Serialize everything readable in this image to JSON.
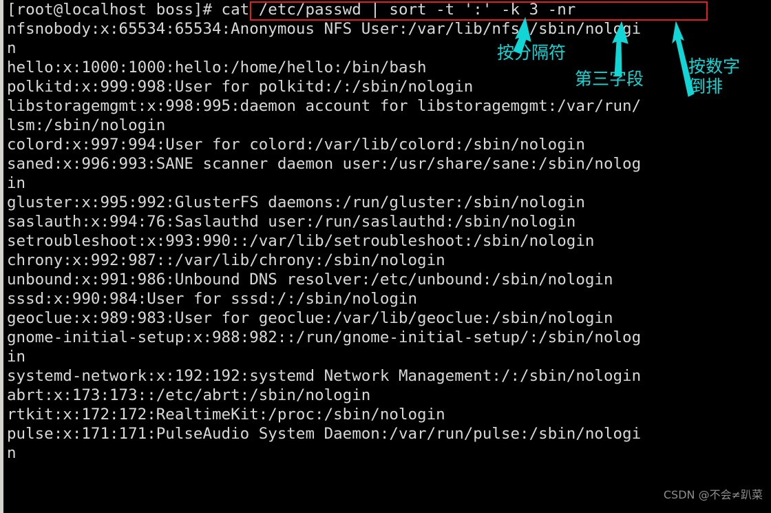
{
  "terminal": {
    "prompt": "[root@localhost boss]#",
    "command": " cat /etc/passwd | sort -t ':' -k 3 -nr",
    "prompt_line": "[root@localhost boss]# cat /etc/passwd | sort -t ':' -k 3 -nr",
    "output_lines": [
      "nfsnobody:x:65534:65534:Anonymous NFS User:/var/lib/nfs:/sbin/nologi",
      "n",
      "hello:x:1000:1000:hello:/home/hello:/bin/bash",
      "polkitd:x:999:998:User for polkitd:/:/sbin/nologin",
      "libstoragemgmt:x:998:995:daemon account for libstoragemgmt:/var/run/",
      "lsm:/sbin/nologin",
      "colord:x:997:994:User for colord:/var/lib/colord:/sbin/nologin",
      "saned:x:996:993:SANE scanner daemon user:/usr/share/sane:/sbin/nolog",
      "in",
      "gluster:x:995:992:GlusterFS daemons:/run/gluster:/sbin/nologin",
      "saslauth:x:994:76:Saslauthd user:/run/saslauthd:/sbin/nologin",
      "setroubleshoot:x:993:990::/var/lib/setroubleshoot:/sbin/nologin",
      "chrony:x:992:987::/var/lib/chrony:/sbin/nologin",
      "unbound:x:991:986:Unbound DNS resolver:/etc/unbound:/sbin/nologin",
      "sssd:x:990:984:User for sssd:/:/sbin/nologin",
      "geoclue:x:989:983:User for geoclue:/var/lib/geoclue:/sbin/nologin",
      "gnome-initial-setup:x:988:982::/run/gnome-initial-setup/:/sbin/nolog",
      "in",
      "systemd-network:x:192:192:systemd Network Management:/:/sbin/nologin",
      "abrt:x:173:173::/etc/abrt:/sbin/nologin",
      "rtkit:x:172:172:RealtimeKit:/proc:/sbin/nologin",
      "pulse:x:171:171:PulseAudio System Daemon:/var/run/pulse:/sbin/nologi",
      "n"
    ]
  },
  "annotations": {
    "color": "#12d6d6",
    "delimiter": "按分隔符",
    "third_field": "第三字段",
    "numeric_desc": "按数字\n倒排",
    "highlight_color": "#e02020"
  },
  "watermark": {
    "text": "CSDN @不会≠趴菜"
  }
}
